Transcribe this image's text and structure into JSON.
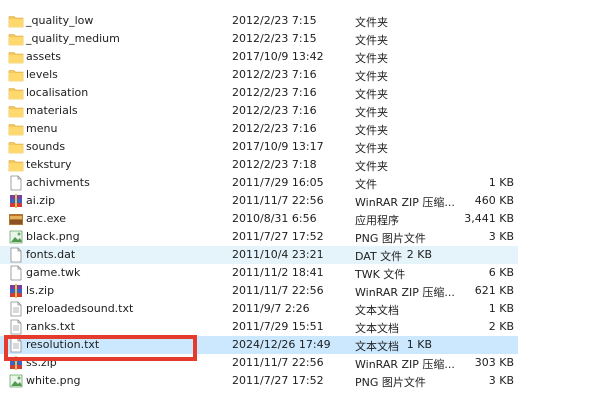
{
  "colors": {
    "highlight": "#e5f3fb",
    "selected": "#cce8ff",
    "annotation_box": "#e53b2c",
    "folder": "#f4c75a"
  },
  "files": [
    {
      "name": "_quality_low",
      "date": "2012/2/23 7:15",
      "type": "文件夹",
      "size": "",
      "icon": "folder-icon",
      "state": ""
    },
    {
      "name": "_quality_medium",
      "date": "2012/2/23 7:15",
      "type": "文件夹",
      "size": "",
      "icon": "folder-icon",
      "state": ""
    },
    {
      "name": "assets",
      "date": "2017/10/9 13:42",
      "type": "文件夹",
      "size": "",
      "icon": "folder-icon",
      "state": ""
    },
    {
      "name": "levels",
      "date": "2012/2/23 7:16",
      "type": "文件夹",
      "size": "",
      "icon": "folder-icon",
      "state": ""
    },
    {
      "name": "localisation",
      "date": "2012/2/23 7:16",
      "type": "文件夹",
      "size": "",
      "icon": "folder-icon",
      "state": ""
    },
    {
      "name": "materials",
      "date": "2012/2/23 7:16",
      "type": "文件夹",
      "size": "",
      "icon": "folder-icon",
      "state": ""
    },
    {
      "name": "menu",
      "date": "2012/2/23 7:16",
      "type": "文件夹",
      "size": "",
      "icon": "folder-icon",
      "state": ""
    },
    {
      "name": "sounds",
      "date": "2017/10/9 13:17",
      "type": "文件夹",
      "size": "",
      "icon": "folder-icon",
      "state": ""
    },
    {
      "name": "teksturу",
      "date": "2012/2/23 7:18",
      "type": "文件夹",
      "size": "",
      "icon": "folder-icon",
      "state": ""
    },
    {
      "name": "achivments",
      "date": "2011/7/29 16:05",
      "type": "文件",
      "size": "1 KB",
      "icon": "file-icon",
      "state": ""
    },
    {
      "name": "ai.zip",
      "date": "2011/11/7 22:56",
      "type": "WinRAR ZIP 压缩...",
      "size": "460 KB",
      "icon": "winrar-zip-icon",
      "state": ""
    },
    {
      "name": "arc.exe",
      "date": "2010/8/31 6:56",
      "type": "应用程序",
      "size": "3,441 KB",
      "icon": "exe-icon",
      "state": ""
    },
    {
      "name": "black.png",
      "date": "2011/7/27 17:52",
      "type": "PNG 图片文件",
      "size": "3 KB",
      "icon": "png-icon",
      "state": ""
    },
    {
      "name": "fonts.dat",
      "date": "2011/10/4 23:21",
      "type": "DAT 文件",
      "size": "2 KB",
      "icon": "file-icon",
      "state": "hl"
    },
    {
      "name": "game.twk",
      "date": "2011/11/2 18:41",
      "type": "TWK 文件",
      "size": "6 KB",
      "icon": "file-icon",
      "state": ""
    },
    {
      "name": "ls.zip",
      "date": "2011/11/7 22:56",
      "type": "WinRAR ZIP 压缩...",
      "size": "621 KB",
      "icon": "winrar-zip-icon",
      "state": ""
    },
    {
      "name": "preloadedsound.txt",
      "date": "2011/9/7 2:26",
      "type": "文本文档",
      "size": "1 KB",
      "icon": "text-file-icon",
      "state": ""
    },
    {
      "name": "ranks.txt",
      "date": "2011/7/29 15:51",
      "type": "文本文档",
      "size": "2 KB",
      "icon": "text-file-icon",
      "state": ""
    },
    {
      "name": "resolution.txt",
      "date": "2024/12/26 17:49",
      "type": "文本文档",
      "size": "1 KB",
      "icon": "text-file-icon",
      "state": "sel"
    },
    {
      "name": "ss.zip",
      "date": "2011/11/7 22:56",
      "type": "WinRAR ZIP 压缩...",
      "size": "303 KB",
      "icon": "winrar-zip-icon",
      "state": ""
    },
    {
      "name": "white.png",
      "date": "2011/7/27 17:52",
      "type": "PNG 图片文件",
      "size": "3 KB",
      "icon": "png-icon",
      "state": ""
    }
  ]
}
